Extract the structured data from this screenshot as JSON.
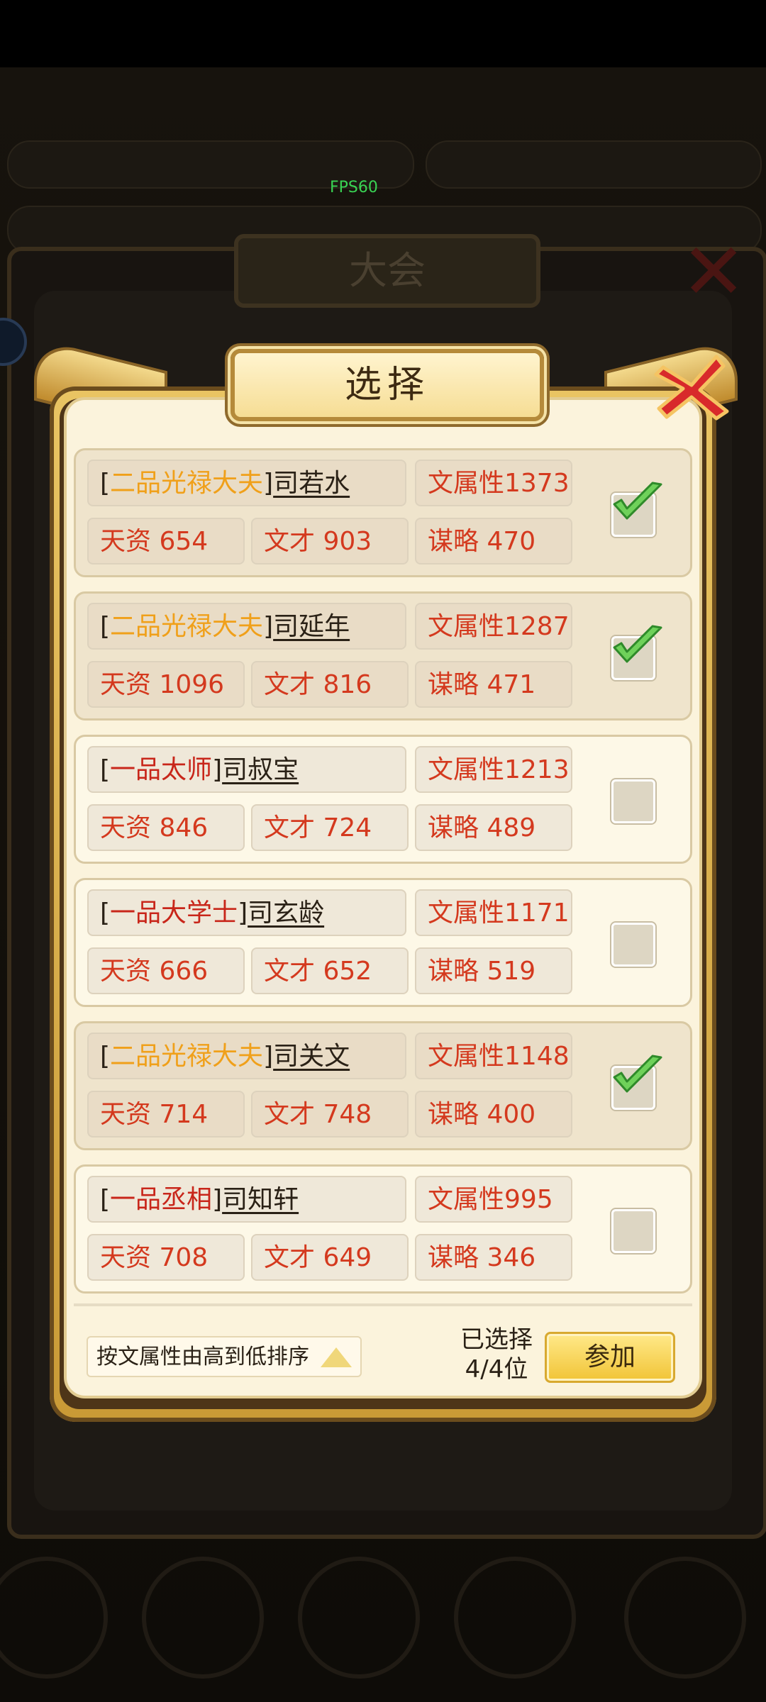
{
  "status": {
    "fps": "FPS60"
  },
  "background": {
    "title": "大会"
  },
  "dialog": {
    "title": "选择",
    "candidates": [
      {
        "rank": "二品光禄大夫",
        "rank_color": "#f0a01a",
        "name": "司若水",
        "attr": "文属性1373",
        "tianzi": "天资 654",
        "wencai": "文才 903",
        "moulue": "谋略 470",
        "selected": true
      },
      {
        "rank": "二品光禄大夫",
        "rank_color": "#f0a01a",
        "name": "司延年",
        "attr": "文属性1287",
        "tianzi": "天资 1096",
        "wencai": "文才 816",
        "moulue": "谋略 471",
        "selected": true
      },
      {
        "rank": "一品太师",
        "rank_color": "#c8261a",
        "name": "司叔宝",
        "attr": "文属性1213",
        "tianzi": "天资 846",
        "wencai": "文才 724",
        "moulue": "谋略 489",
        "selected": false
      },
      {
        "rank": "一品大学士",
        "rank_color": "#c8261a",
        "name": "司玄龄",
        "attr": "文属性1171",
        "tianzi": "天资 666",
        "wencai": "文才 652",
        "moulue": "谋略 519",
        "selected": false
      },
      {
        "rank": "二品光禄大夫",
        "rank_color": "#f0a01a",
        "name": "司关文",
        "attr": "文属性1148",
        "tianzi": "天资 714",
        "wencai": "文才 748",
        "moulue": "谋略 400",
        "selected": true
      },
      {
        "rank": "一品丞相",
        "rank_color": "#c8261a",
        "name": "司知轩",
        "attr": "文属性995",
        "tianzi": "天资 708",
        "wencai": "文才 649",
        "moulue": "谋略 346",
        "selected": false
      }
    ],
    "sort_label": "按文属性由高到低排序",
    "selected_label": "已选择",
    "selected_count": "4/4位",
    "join_label": "参加"
  },
  "icons": {
    "close": "close-icon",
    "sort": "triangle-up-icon",
    "check": "checkmark-icon"
  }
}
